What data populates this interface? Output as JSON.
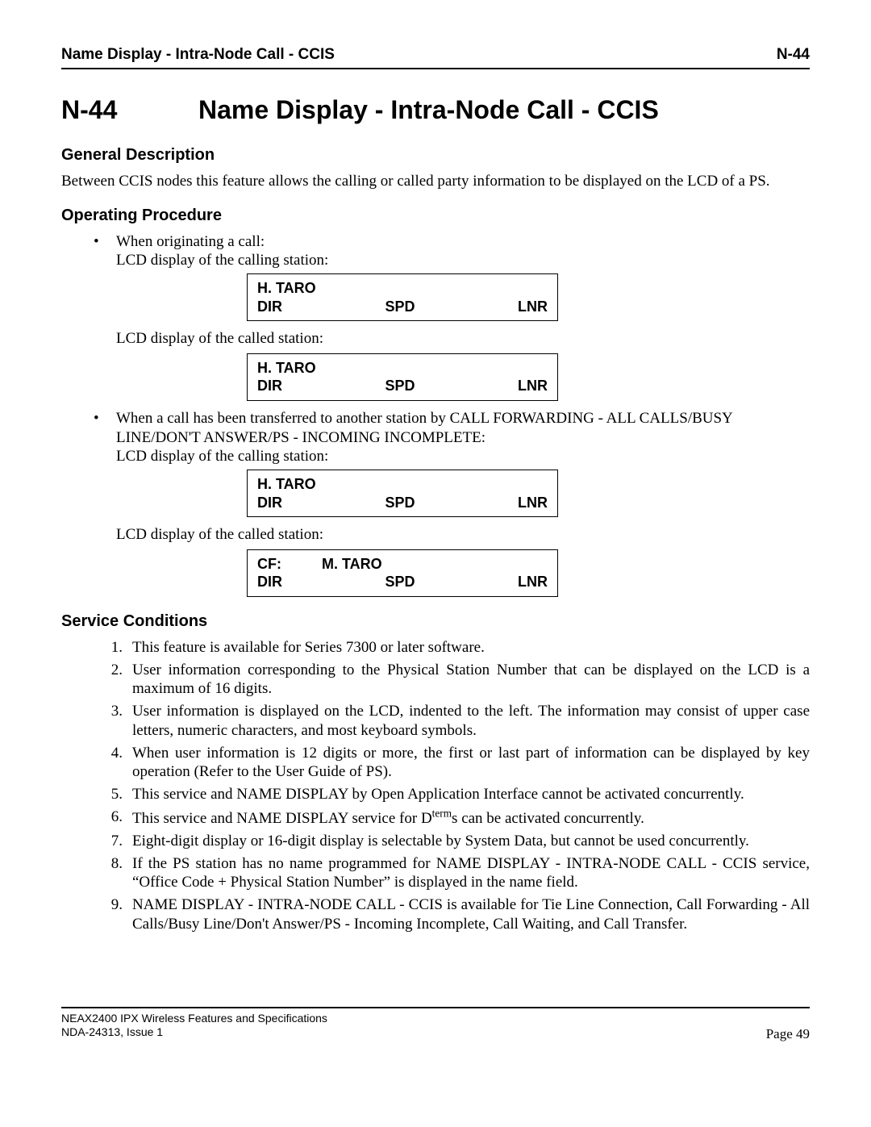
{
  "header": {
    "title": "Name Display - Intra-Node Call - CCIS",
    "code": "N-44"
  },
  "title": {
    "code": "N-44",
    "text": "Name Display - Intra-Node Call - CCIS"
  },
  "sections": {
    "general": {
      "heading": "General Description",
      "body": "Between CCIS nodes this feature allows the calling or called party information to be displayed on the LCD of a PS."
    },
    "operating": {
      "heading": "Operating Procedure",
      "b1_intro": "When originating a call:",
      "b1_line1": "LCD display of the calling station:",
      "lcd1": {
        "top": "H. TARO",
        "a": "DIR",
        "b": "SPD",
        "c": "LNR"
      },
      "b1_line2": "LCD display of the called station:",
      "lcd2": {
        "top": "H. TARO",
        "a": "DIR",
        "b": "SPD",
        "c": "LNR"
      },
      "b2_intro": "When a call has been transferred to another station by CALL FORWARDING - ALL CALLS/BUSY LINE/DON'T ANSWER/PS - INCOMING INCOMPLETE:",
      "b2_line1": "LCD display of the calling station:",
      "lcd3": {
        "top": "H. TARO",
        "a": "DIR",
        "b": "SPD",
        "c": "LNR"
      },
      "b2_line2": "LCD display of the called station:",
      "lcd4": {
        "top1": "CF:",
        "top2": "M. TARO",
        "a": "DIR",
        "b": "SPD",
        "c": "LNR"
      }
    },
    "service": {
      "heading": "Service Conditions",
      "items": [
        "This feature is available for Series 7300 or later software.",
        "User information corresponding to the Physical Station Number that can be displayed on the LCD is a maximum of 16 digits.",
        "User information is displayed on the LCD, indented to the left. The information may consist of upper case letters, numeric characters, and most keyboard symbols.",
        "When user information is 12 digits or more, the first or last part of information can be displayed by key operation (Refer to the User Guide of PS).",
        "This service and NAME DISPLAY by Open Application Interface cannot be activated concurrently.",
        "This service and NAME DISPLAY service for D___s can be activated concurrently.",
        "Eight-digit display or 16-digit display is selectable by System Data, but cannot be used concurrently.",
        "If the PS station has no name programmed for NAME DISPLAY - INTRA-NODE CALL - CCIS service, “Office Code + Physical Station Number” is displayed in the name field.",
        "NAME DISPLAY - INTRA-NODE CALL - CCIS is available for Tie Line Connection, Call Forwarding - All Calls/Busy Line/Don't Answer/PS - Incoming Incomplete, Call Waiting, and Call Transfer."
      ],
      "item6_pre": "This service and NAME DISPLAY service for D",
      "item6_sup": "term",
      "item6_post": "s can be activated concurrently."
    }
  },
  "footer": {
    "line1": "NEAX2400 IPX Wireless Features and Specifications",
    "line2": "NDA-24313, Issue 1",
    "page": "Page 49"
  }
}
